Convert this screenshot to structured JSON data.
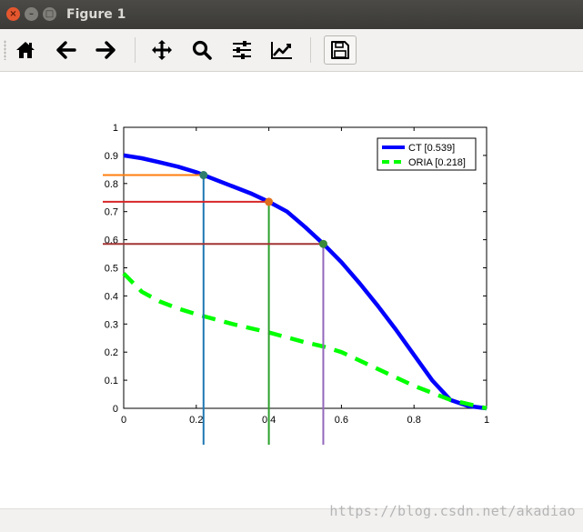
{
  "window": {
    "title": "Figure 1",
    "close_glyph": "×",
    "min_glyph": "–",
    "max_glyph": "□"
  },
  "toolbar": {
    "buttons": [
      {
        "name": "home-button",
        "icon": "home-icon"
      },
      {
        "name": "back-button",
        "icon": "arrow-left-icon"
      },
      {
        "name": "forward-button",
        "icon": "arrow-right-icon"
      },
      {
        "name": "pan-button",
        "icon": "move-icon"
      },
      {
        "name": "zoom-button",
        "icon": "magnifier-icon"
      },
      {
        "name": "subplots-button",
        "icon": "sliders-icon"
      },
      {
        "name": "edit-axes-button",
        "icon": "line-chart-icon"
      },
      {
        "name": "save-button",
        "icon": "floppy-disk-icon"
      }
    ]
  },
  "watermark": "https://blog.csdn.net/akadiao",
  "chart_data": {
    "type": "line",
    "xlim": [
      0,
      1
    ],
    "ylim": [
      0,
      1
    ],
    "x_ticks": [
      "0",
      "0.2",
      "0.4",
      "0.6",
      "0.8",
      "1"
    ],
    "y_ticks": [
      "0",
      "0.1",
      "0.2",
      "0.3",
      "0.4",
      "0.5",
      "0.6",
      "0.7",
      "0.8",
      "0.9",
      "1"
    ],
    "legend_position": "top-right",
    "series": [
      {
        "name": "CT [0.539]",
        "color": "#0000ff",
        "style": "solid",
        "x": [
          0,
          0.05,
          0.1,
          0.15,
          0.2,
          0.25,
          0.3,
          0.35,
          0.4,
          0.45,
          0.5,
          0.55,
          0.6,
          0.65,
          0.7,
          0.75,
          0.8,
          0.85,
          0.9,
          0.95,
          1
        ],
        "y": [
          0.9,
          0.89,
          0.875,
          0.86,
          0.84,
          0.815,
          0.79,
          0.765,
          0.735,
          0.7,
          0.645,
          0.585,
          0.52,
          0.445,
          0.365,
          0.28,
          0.19,
          0.1,
          0.03,
          0.008,
          0
        ]
      },
      {
        "name": "ORIA [0.218]",
        "color": "#00ff00",
        "style": "dashed",
        "x": [
          0,
          0.05,
          0.1,
          0.15,
          0.2,
          0.3,
          0.4,
          0.5,
          0.55,
          0.6,
          0.7,
          0.8,
          0.9,
          1
        ],
        "y": [
          0.48,
          0.415,
          0.38,
          0.355,
          0.335,
          0.3,
          0.27,
          0.235,
          0.22,
          0.2,
          0.14,
          0.08,
          0.03,
          0
        ]
      }
    ],
    "markers": [
      {
        "x": 0.22,
        "y": 0.83,
        "h_color": "#ff7f0e",
        "v_color": "#1f77b4",
        "dot_color": "#2e7d6e"
      },
      {
        "x": 0.4,
        "y": 0.735,
        "h_color": "#d62728",
        "v_color": "#2ca02c",
        "dot_color": "#e0701e"
      },
      {
        "x": 0.55,
        "y": 0.585,
        "h_color": "#a33434",
        "v_color": "#9467bd",
        "dot_color": "#3a8a3a"
      }
    ]
  }
}
